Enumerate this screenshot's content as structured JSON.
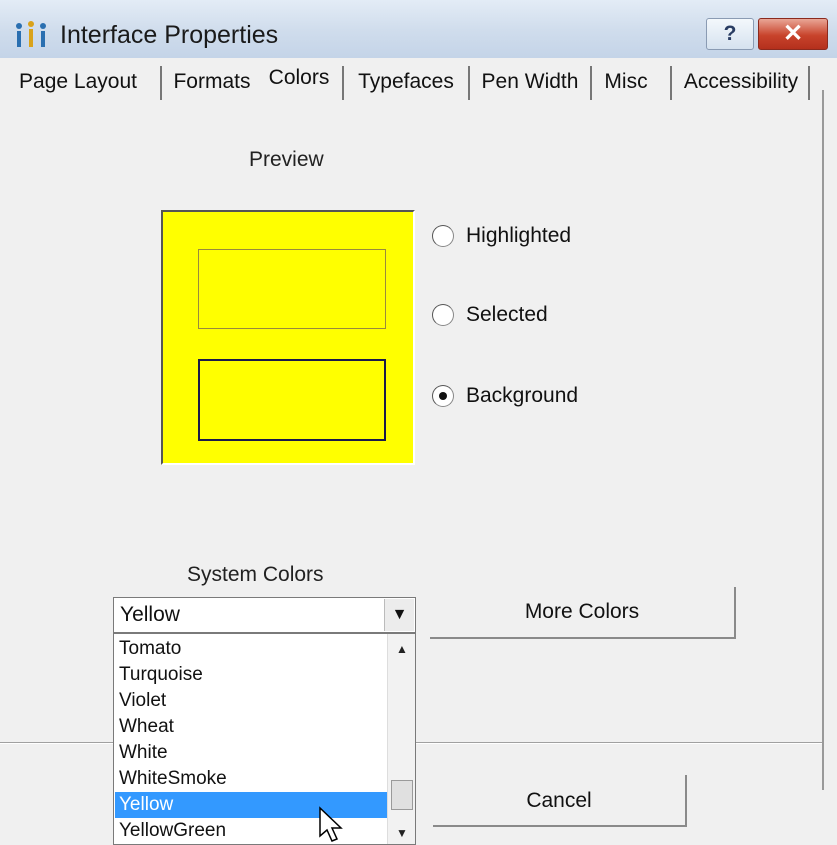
{
  "window": {
    "title": "Interface Properties",
    "help_label": "?",
    "close_label": "✕"
  },
  "tabs": [
    {
      "label": "Page Layout"
    },
    {
      "label": "Formats"
    },
    {
      "label": "Colors"
    },
    {
      "label": "Typefaces"
    },
    {
      "label": "Pen Width"
    },
    {
      "label": "Misc"
    },
    {
      "label": "Accessibility"
    }
  ],
  "active_tab": "Colors",
  "preview": {
    "label": "Preview",
    "background_color": "#ffff00",
    "radios": [
      {
        "label": "Highlighted",
        "checked": false
      },
      {
        "label": "Selected",
        "checked": false
      },
      {
        "label": "Background",
        "checked": true
      }
    ]
  },
  "system_colors": {
    "label": "System Colors",
    "selected": "Yellow",
    "options": [
      "Tomato",
      "Turquoise",
      "Violet",
      "Wheat",
      "White",
      "WhiteSmoke",
      "Yellow",
      "YellowGreen"
    ],
    "highlighted_option": "Yellow"
  },
  "buttons": {
    "more_colors": "More Colors",
    "cancel": "Cancel"
  },
  "colors": {
    "selection": "#3399ff",
    "close_button": "#c8432b"
  },
  "icons": {
    "app": "app-icon",
    "dropdown": "chevron-down-icon",
    "scroll_up": "scroll-up-icon",
    "scroll_down": "scroll-down-icon",
    "cursor": "mouse-pointer-icon"
  }
}
